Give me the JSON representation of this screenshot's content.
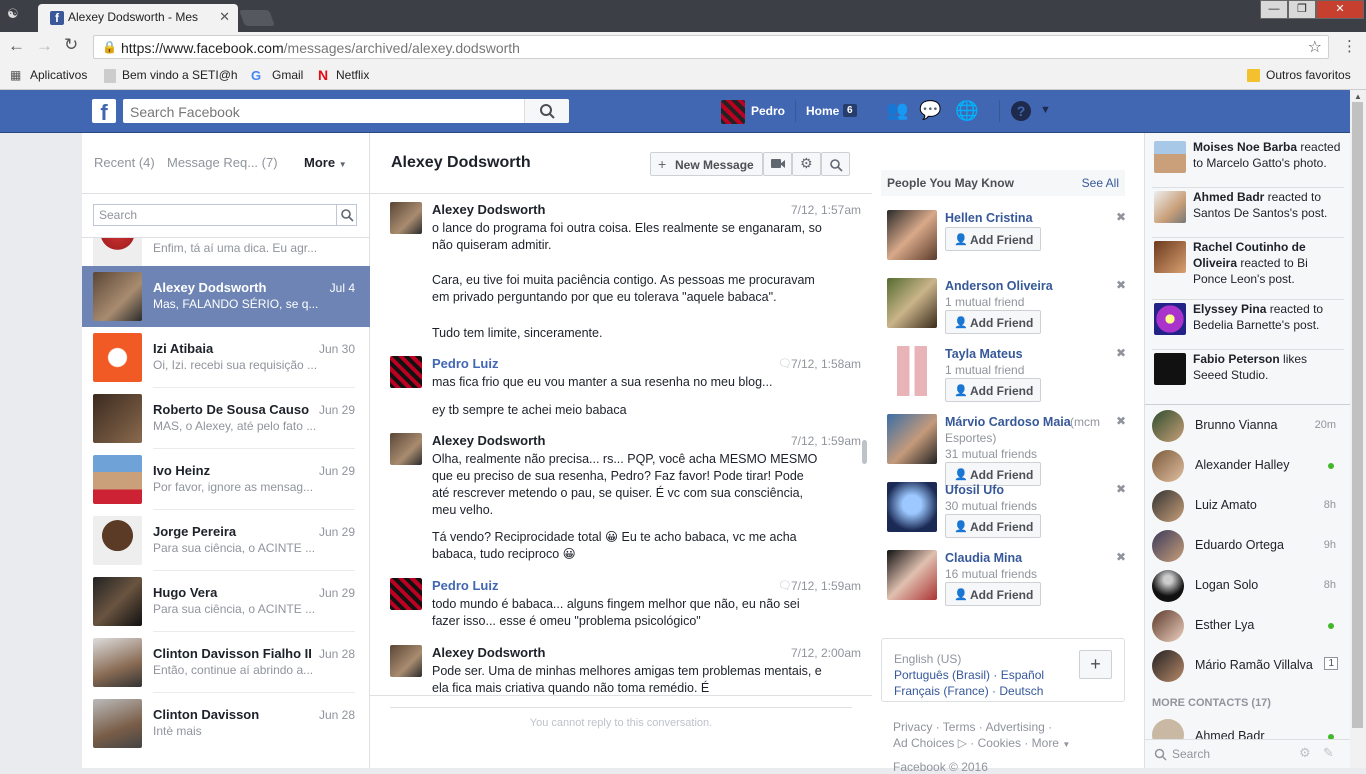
{
  "browser": {
    "tab_title": "Alexey Dodsworth - Mes",
    "url_host": "https://www.facebook.com",
    "url_path": "/messages/archived/alexey.dodsworth",
    "bookmarks": [
      "Aplicativos",
      "Bem vindo a SETI@ho",
      "Gmail",
      "Netflix"
    ],
    "other_bookmarks": "Outros favoritos"
  },
  "fb": {
    "search_placeholder": "Search Facebook",
    "profile_name": "Pedro",
    "home_label": "Home",
    "home_count": "6"
  },
  "inbox": {
    "tab_recent": "Recent",
    "tab_recent_count": "(4)",
    "tab_requests": "Message Req...",
    "tab_requests_count": "(7)",
    "more_label": "More",
    "search_placeholder": "Search",
    "partial_snippet": "Enfim, tá aí uma dica. Eu agr...",
    "conversations": [
      {
        "name": "Alexey Dodsworth",
        "date": "Jul 4",
        "snippet": "Mas, FALANDO SÉRIO, se q...",
        "selected": true
      },
      {
        "name": "Izi Atibaia",
        "date": "Jun 30",
        "snippet": "Oi, Izi. recebi sua requisição ..."
      },
      {
        "name": "Roberto De Sousa Causo",
        "date": "Jun 29",
        "snippet": "MAS, o Alexey, até pelo fato ..."
      },
      {
        "name": "Ivo Heinz",
        "date": "Jun 29",
        "snippet": "Por favor, ignore as mensag..."
      },
      {
        "name": "Jorge Pereira",
        "date": "Jun 29",
        "snippet": "Para sua ciência, o ACINTE ..."
      },
      {
        "name": "Hugo Vera",
        "date": "Jun 29",
        "snippet": "Para sua ciência, o ACINTE ..."
      },
      {
        "name": "Clinton Davisson Fialho II",
        "date": "Jun 28",
        "snippet": "Então, continue aí abrindo a..."
      },
      {
        "name": "Clinton Davisson",
        "date": "Jun 28",
        "snippet": "Intè mais"
      }
    ]
  },
  "thread": {
    "title": "Alexey Dodsworth",
    "new_message_label": "New Message",
    "no_reply_text": "You cannot reply to this conversation.",
    "messages": [
      {
        "sender": "Alexey Dodsworth",
        "time": "7/12, 1:57am",
        "paragraphs": [
          "o lance do programa foi outra coisa. Eles realmente se enganaram, so não quiseram admitir.",
          "Cara, eu tive foi muita paciência contigo. As pessoas me procuravam em privado perguntando por que eu tolerava \"aquele babaca\".",
          "Tudo tem limite, sinceramente."
        ]
      },
      {
        "sender": "Pedro Luiz",
        "time": "7/12, 1:58am",
        "paragraphs": [
          "mas fica frio que eu vou manter a sua resenha no meu blog...",
          "ey tb sempre te achei meio babaca"
        ]
      },
      {
        "sender": "Alexey Dodsworth",
        "time": "7/12, 1:59am",
        "paragraphs": [
          "Olha, realmente não precisa... rs... PQP, você acha MESMO MESMO que eu preciso de sua resenha, Pedro? Faz favor! Pode tirar! Pode até rescrever metendo o pau, se quiser. É vc com sua consciência, meu velho.",
          "Tá vendo? Reciprocidade total 😀 Eu te acho babaca, vc me acha babaca, tudo reciproco 😀"
        ]
      },
      {
        "sender": "Pedro Luiz",
        "time": "7/12, 1:59am",
        "paragraphs": [
          "todo mundo é babaca... alguns fingem melhor que não, eu não sei fazer isso... esse é omeu \"problema psicológico\""
        ]
      },
      {
        "sender": "Alexey Dodsworth",
        "time": "7/12, 2:00am",
        "paragraphs": [
          "Pode ser. Uma de minhas melhores amigas tem problemas mentais, e ela fica mais criativa quando não toma remédio. É"
        ]
      }
    ]
  },
  "pymk": {
    "title": "People You May Know",
    "see_all": "See All",
    "add_label": "Add Friend",
    "people": [
      {
        "name": "Hellen Cristina",
        "sub": ""
      },
      {
        "name": "Anderson Oliveira",
        "sub": "1 mutual friend"
      },
      {
        "name": "Tayla Mateus",
        "sub": "1 mutual friend"
      },
      {
        "name": "Márvio Cardoso Maia",
        "name_extra": "(mcm",
        "sub_extra": "Esportes)",
        "sub": "31 mutual friends"
      },
      {
        "name": "Ufosil Ufo",
        "sub": "30 mutual friends"
      },
      {
        "name": "Claudia Mina",
        "sub": "16 mutual friends"
      }
    ]
  },
  "languages": {
    "current": "English (US)",
    "line2": "Português (Brasil) · Español",
    "line3": "Français (France) · Deutsch"
  },
  "footer": {
    "line1": "Privacy · Terms · Advertising ·",
    "line2": "Ad Choices",
    "line2b": "· Cookies · More",
    "line3": "Facebook © 2016"
  },
  "ticker": [
    {
      "name": "Moises Noe Barba",
      "action": " reacted to Marcelo Gatto's photo."
    },
    {
      "name": "Ahmed Badr",
      "action": " reacted to Santos De Santos's post."
    },
    {
      "name": "Rachel Coutinho de Oliveira",
      "action": " reacted to Bi Ponce Leon's post."
    },
    {
      "name": "Elyssey Pina",
      "action": " reacted to Bedelia Barnette's post."
    },
    {
      "name": "Fabio Peterson",
      "action": " likes Seeed Studio."
    }
  ],
  "contacts": [
    {
      "name": "Brunno Vianna",
      "status": "20m"
    },
    {
      "name": "Alexander Halley",
      "status": "online"
    },
    {
      "name": "Luiz Amato",
      "status": "8h"
    },
    {
      "name": "Eduardo Ortega",
      "status": "9h"
    },
    {
      "name": "Logan Solo",
      "status": "8h"
    },
    {
      "name": "Esther Lya",
      "status": "online"
    },
    {
      "name": "Mário Ramão Villalva",
      "status": "1"
    }
  ],
  "more_contacts_label": "MORE CONTACTS (17)",
  "more_contact_first": "Ahmed Badr",
  "chat_search_placeholder": "Search",
  "colors": {
    "fb_blue": "#4267b2",
    "selected_row": "#6d84b4",
    "online": "#42b72a"
  }
}
